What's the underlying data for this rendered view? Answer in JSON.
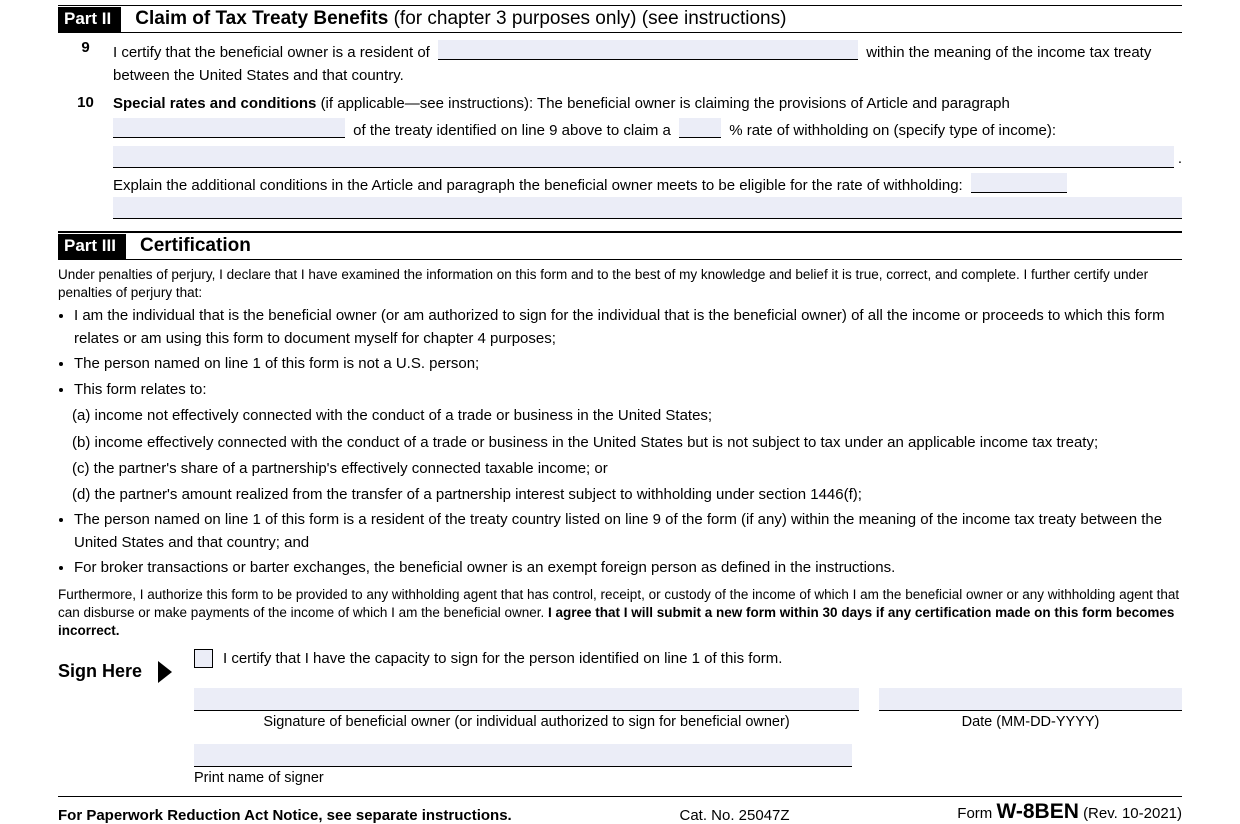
{
  "part2": {
    "tag": "Part II",
    "title": "Claim of Tax Treaty Benefits",
    "paren": "(for chapter 3 purposes only) (see instructions)"
  },
  "line9": {
    "num": "9",
    "text_a": "I certify that the beneficial owner is a resident of",
    "text_b": "within the meaning of the income tax treaty between the United States and that country."
  },
  "line10": {
    "num": "10",
    "lead_bold": "Special rates and conditions",
    "lead_rest": "(if applicable—see instructions): The beneficial owner is claiming the provisions of Article and paragraph",
    "mid": "of the treaty identified on line 9 above to claim a",
    "pct": "% rate of withholding on (specify type of income):",
    "explain": "Explain the additional conditions in the Article and paragraph the beneficial owner meets to be eligible for the rate of withholding:"
  },
  "part3": {
    "tag": "Part III",
    "title": "Certification",
    "intro": "Under penalties of perjury, I declare that I have examined the information on this form and to the best of my knowledge and belief it is true, correct, and complete. I further certify under penalties of perjury that:",
    "bullets": [
      "I am the individual that is the beneficial owner (or am authorized to sign for the individual that is the beneficial owner) of all the income or proceeds to which this form relates or am using this form to document myself for chapter 4 purposes;",
      "The person named on line 1 of this form is not a U.S. person;",
      "This form relates to:"
    ],
    "sub": [
      "(a) income not effectively connected with the conduct of a trade or business in the United States;",
      "(b) income effectively connected with the conduct of a trade or business in the United States but is not subject to tax under an applicable income tax treaty;",
      "(c) the partner's share of a partnership's effectively connected taxable income; or",
      "(d) the partner's amount realized from the transfer of a partnership interest subject to withholding under section 1446(f);"
    ],
    "bullets2": [
      "The person named on line 1 of this form is a resident of the treaty country listed on line 9 of the form (if any) within the meaning of the income tax treaty between the United States and that country; and",
      "For broker transactions or barter exchanges, the beneficial owner is an exempt foreign person as defined in the instructions."
    ],
    "furthermore_a": "Furthermore, I authorize this form to be provided to any withholding agent that has control, receipt, or custody of the income of which I am the beneficial owner or any withholding agent that can disburse or make payments of the income of which I am the beneficial owner. ",
    "furthermore_b": "I agree that I will submit a new form within 30 days if any certification made on this form becomes incorrect.",
    "capacity": "I certify that I have the capacity to sign for the person identified on line 1 of this form.",
    "sign_here": "Sign Here",
    "sig_label": "Signature of beneficial owner (or individual authorized to sign for beneficial owner)",
    "date_label": "Date (MM-DD-YYYY)",
    "print_label": "Print name of signer"
  },
  "footer": {
    "left": "For Paperwork Reduction Act Notice, see separate instructions.",
    "cat": "Cat. No. 25047Z",
    "form_word": "Form",
    "form_name": "W-8BEN",
    "rev": "(Rev. 10-2021)"
  }
}
